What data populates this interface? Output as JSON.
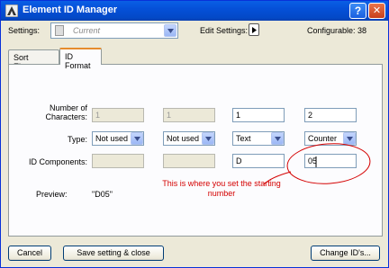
{
  "window": {
    "title": "Element ID Manager",
    "help_glyph": "?",
    "close_glyph": "✕"
  },
  "header": {
    "settings_label": "Settings:",
    "settings_value": "Current",
    "edit_settings_label": "Edit Settings:",
    "configurable_label": "Configurable: 38"
  },
  "tabs": [
    {
      "label": "Sort Elements"
    },
    {
      "label": "ID Format"
    }
  ],
  "form": {
    "num_chars_label_1": "Number of",
    "num_chars_label_2": "Characters:",
    "type_label": "Type:",
    "id_components_label": "ID Components:",
    "columns": [
      {
        "chars": "1",
        "type": "Not used",
        "component": ""
      },
      {
        "chars": "1",
        "type": "Not used",
        "component": ""
      },
      {
        "chars": "1",
        "type": "Text",
        "component": "D"
      },
      {
        "chars": "2",
        "type": "Counter",
        "component": "05"
      }
    ],
    "preview_label": "Preview:",
    "preview_value": "\"D05\""
  },
  "annotation": {
    "text": "This is where you set the starting number",
    "color": "#d40000"
  },
  "buttons": {
    "cancel": "Cancel",
    "save": "Save setting & close",
    "change": "Change ID's..."
  },
  "colors": {
    "titlebar": "#0550d8",
    "dialog_bg": "#ece9d8",
    "tab_highlight": "#e68b2c"
  }
}
